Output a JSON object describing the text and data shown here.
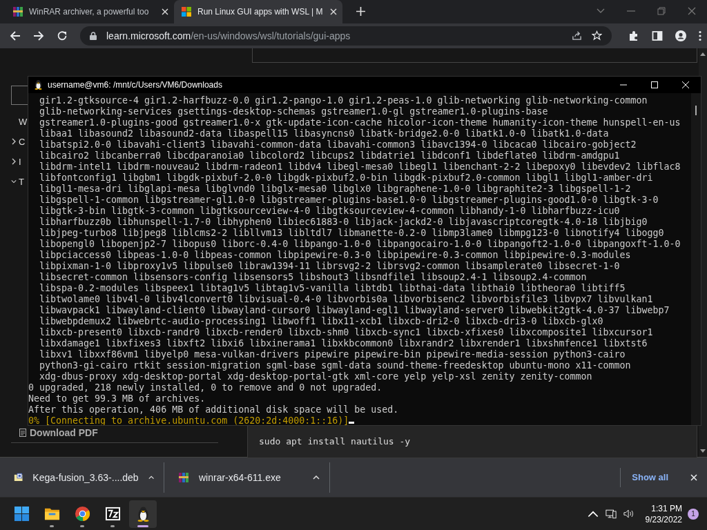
{
  "browser": {
    "tabs": [
      {
        "title": "WinRAR archiver, a powerful too",
        "kind": "rar",
        "selected": false
      },
      {
        "title": "Run Linux GUI apps with WSL | M",
        "kind": "windows",
        "selected": true
      }
    ],
    "address": {
      "domain": "learn.microsoft.com",
      "path": "/en-us/windows/wsl/tutorials/gui-apps"
    }
  },
  "page": {
    "sidebar_items": [
      {
        "label": "W",
        "kind": "plain"
      },
      {
        "label": "C",
        "kind": "collapsed"
      },
      {
        "label": "I",
        "kind": "collapsed"
      },
      {
        "label": "T",
        "kind": "expanded"
      }
    ],
    "download_pdf": "Download PDF",
    "code": "sudo apt install nautilus -y"
  },
  "terminal": {
    "title": "username@vm6: /mnt/c/Users/VM6/Downloads",
    "lines": [
      {
        "kind": "package",
        "text": "gir1.2-gtksource-4 gir1.2-harfbuzz-0.0 gir1.2-pango-1.0 gir1.2-peas-1.0 glib-networking glib-networking-common"
      },
      {
        "kind": "package",
        "text": "glib-networking-services gsettings-desktop-schemas gstreamer1.0-gl gstreamer1.0-plugins-base"
      },
      {
        "kind": "package",
        "text": "gstreamer1.0-plugins-good gstreamer1.0-x gtk-update-icon-cache hicolor-icon-theme humanity-icon-theme hunspell-en-us"
      },
      {
        "kind": "package",
        "text": "libaa1 libasound2 libasound2-data libaspell15 libasyncns0 libatk-bridge2.0-0 libatk1.0-0 libatk1.0-data"
      },
      {
        "kind": "package",
        "text": "libatspi2.0-0 libavahi-client3 libavahi-common-data libavahi-common3 libavc1394-0 libcaca0 libcairo-gobject2"
      },
      {
        "kind": "package",
        "text": "libcairo2 libcanberra0 libcdparanoia0 libcolord2 libcups2 libdatrie1 libdconf1 libdeflate0 libdrm-amdgpu1"
      },
      {
        "kind": "package",
        "text": "libdrm-intel1 libdrm-nouveau2 libdrm-radeon1 libdv4 libegl-mesa0 libegl1 libenchant-2-2 libepoxy0 libevdev2 libflac8"
      },
      {
        "kind": "package",
        "text": "libfontconfig1 libgbm1 libgdk-pixbuf-2.0-0 libgdk-pixbuf2.0-bin libgdk-pixbuf2.0-common libgl1 libgl1-amber-dri"
      },
      {
        "kind": "package",
        "text": "libgl1-mesa-dri libglapi-mesa libglvnd0 libglx-mesa0 libglx0 libgraphene-1.0-0 libgraphite2-3 libgspell-1-2"
      },
      {
        "kind": "package",
        "text": "libgspell-1-common libgstreamer-gl1.0-0 libgstreamer-plugins-base1.0-0 libgstreamer-plugins-good1.0-0 libgtk-3-0"
      },
      {
        "kind": "package",
        "text": "libgtk-3-bin libgtk-3-common libgtksourceview-4-0 libgtksourceview-4-common libhandy-1-0 libharfbuzz-icu0"
      },
      {
        "kind": "package",
        "text": "libharfbuzz0b libhunspell-1.7-0 libhyphen0 libiec61883-0 libjack-jackd2-0 libjavascriptcoregtk-4.0-18 libjbig0"
      },
      {
        "kind": "package",
        "text": "libjpeg-turbo8 libjpeg8 liblcms2-2 libllvm13 libltdl7 libmanette-0.2-0 libmp3lame0 libmpg123-0 libnotify4 libogg0"
      },
      {
        "kind": "package",
        "text": "libopengl0 libopenjp2-7 libopus0 liborc-0.4-0 libpango-1.0-0 libpangocairo-1.0-0 libpangoft2-1.0-0 libpangoxft-1.0-0"
      },
      {
        "kind": "package",
        "text": "libpciaccess0 libpeas-1.0-0 libpeas-common libpipewire-0.3-0 libpipewire-0.3-common libpipewire-0.3-modules"
      },
      {
        "kind": "package",
        "text": "libpixman-1-0 libproxy1v5 libpulse0 libraw1394-11 librsvg2-2 librsvg2-common libsamplerate0 libsecret-1-0"
      },
      {
        "kind": "package",
        "text": "libsecret-common libsensors-config libsensors5 libshout3 libsndfile1 libsoup2.4-1 libsoup2.4-common"
      },
      {
        "kind": "package",
        "text": "libspa-0.2-modules libspeex1 libtag1v5 libtag1v5-vanilla libtdb1 libthai-data libthai0 libtheora0 libtiff5"
      },
      {
        "kind": "package",
        "text": "libtwolame0 libv4l-0 libv4lconvert0 libvisual-0.4-0 libvorbis0a libvorbisenc2 libvorbisfile3 libvpx7 libvulkan1"
      },
      {
        "kind": "package",
        "text": "libwavpack1 libwayland-client0 libwayland-cursor0 libwayland-egl1 libwayland-server0 libwebkit2gtk-4.0-37 libwebp7"
      },
      {
        "kind": "package",
        "text": "libwebpdemux2 libwebrtc-audio-processing1 libwoff1 libx11-xcb1 libxcb-dri2-0 libxcb-dri3-0 libxcb-glx0"
      },
      {
        "kind": "package",
        "text": "libxcb-present0 libxcb-randr0 libxcb-render0 libxcb-shm0 libxcb-sync1 libxcb-xfixes0 libxcomposite1 libxcursor1"
      },
      {
        "kind": "package",
        "text": "libxdamage1 libxfixes3 libxft2 libxi6 libxinerama1 libxkbcommon0 libxrandr2 libxrender1 libxshmfence1 libxtst6"
      },
      {
        "kind": "package",
        "text": "libxv1 libxxf86vm1 libyelp0 mesa-vulkan-drivers pipewire pipewire-bin pipewire-media-session python3-cairo"
      },
      {
        "kind": "package",
        "text": "python3-gi-cairo rtkit session-migration sgml-base sgml-data sound-theme-freedesktop ubuntu-mono x11-common"
      },
      {
        "kind": "package",
        "text": "xdg-dbus-proxy xdg-desktop-portal xdg-desktop-portal-gtk xml-core yelp yelp-xsl zenity zenity-common"
      },
      {
        "kind": "plain",
        "text": "0 upgraded, 218 newly installed, 0 to remove and 0 not upgraded."
      },
      {
        "kind": "plain",
        "text": "Need to get 99.3 MB of archives."
      },
      {
        "kind": "plain",
        "text": "After this operation, 406 MB of additional disk space will be used."
      },
      {
        "kind": "progress",
        "text": "0% [Connecting to archive.ubuntu.com (2620:2d:4000:1::16)]"
      }
    ]
  },
  "downloads": {
    "items": [
      {
        "name": "Kega-fusion_3.63-....deb",
        "kind": "deb"
      },
      {
        "name": "winrar-x64-611.exe",
        "kind": "rar"
      }
    ],
    "show_all": "Show all"
  },
  "taskbar": {
    "apps": [
      {
        "kind": "start",
        "running": false,
        "selected": false
      },
      {
        "kind": "folder",
        "running": true,
        "selected": false
      },
      {
        "kind": "chrome",
        "running": true,
        "selected": false
      },
      {
        "kind": "archiver",
        "running": true,
        "selected": false
      },
      {
        "kind": "penguin",
        "running": true,
        "selected": true
      }
    ],
    "time": "1:31 PM",
    "date": "9/23/2022",
    "notifications": "1"
  }
}
